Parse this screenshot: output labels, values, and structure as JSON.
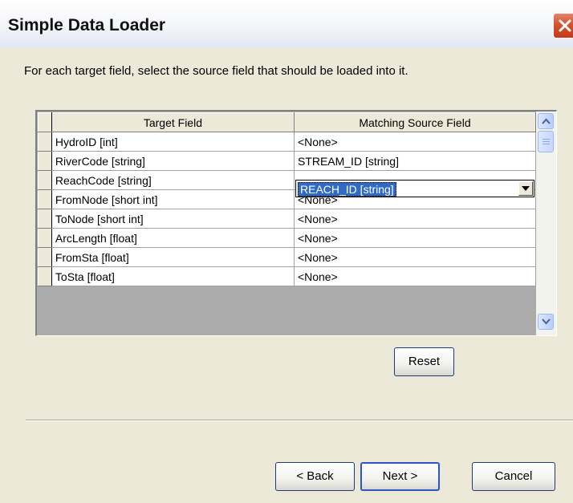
{
  "window": {
    "title": "Simple Data Loader"
  },
  "instructions": "For each target field, select the source field that should be loaded into it.",
  "grid": {
    "columns": [
      "Target Field",
      "Matching Source Field"
    ],
    "rows": [
      {
        "target": "HydroID [int]",
        "source": "<None>"
      },
      {
        "target": "RiverCode [string]",
        "source": "STREAM_ID [string]"
      },
      {
        "target": "ReachCode [string]",
        "source": "REACH_ID [string]"
      },
      {
        "target": "FromNode [short int]",
        "source": "<None>"
      },
      {
        "target": "ToNode [short int]",
        "source": "<None>"
      },
      {
        "target": "ArcLength [float]",
        "source": "<None>"
      },
      {
        "target": "FromSta [float]",
        "source": "<None>"
      },
      {
        "target": "ToSta [float]",
        "source": "<None>"
      }
    ],
    "editing_row": 2
  },
  "buttons": {
    "reset": "Reset",
    "back": "< Back",
    "next": "Next >",
    "cancel": "Cancel"
  },
  "colors": {
    "selection": "#316ac5",
    "window_bg": "#ece9d8",
    "close": "#d5532f"
  },
  "icons": [
    "close-icon",
    "scroll-up-icon",
    "scroll-down-icon",
    "dropdown-arrow-icon"
  ]
}
